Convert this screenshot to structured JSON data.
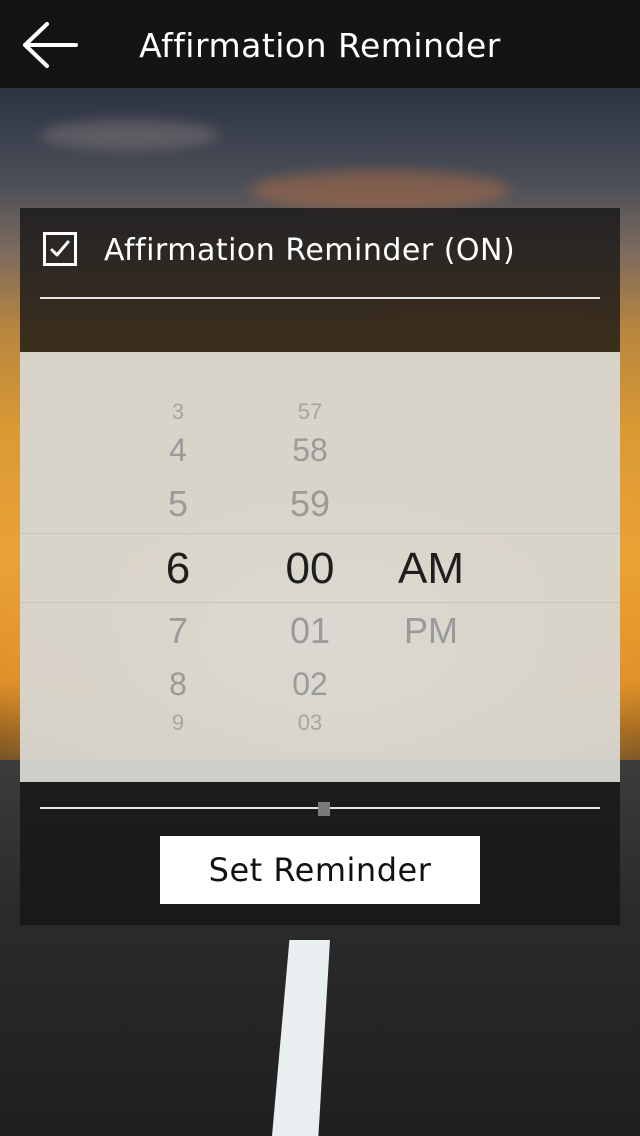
{
  "header": {
    "title": "Affirmation Reminder",
    "back_icon": "arrow-left-icon"
  },
  "reminder_toggle": {
    "label": "Affirmation Reminder (ON)",
    "checked": true,
    "check_icon": "checkmark-icon"
  },
  "time_picker": {
    "hours": {
      "above": [
        "3",
        "4",
        "5"
      ],
      "selected": "6",
      "below": [
        "7",
        "8",
        "9"
      ]
    },
    "minutes": {
      "above": [
        "57",
        "58",
        "59"
      ],
      "selected": "00",
      "below": [
        "01",
        "02",
        "03"
      ]
    },
    "period": {
      "selected": "AM",
      "below": [
        "PM"
      ]
    }
  },
  "actions": {
    "set_label": "Set Reminder"
  },
  "colors": {
    "topbar": "#141414",
    "panel": "#141414",
    "button_bg": "#ffffff",
    "selected_text": "#1e1e1e",
    "unselected_text": "#9a9a9a"
  }
}
